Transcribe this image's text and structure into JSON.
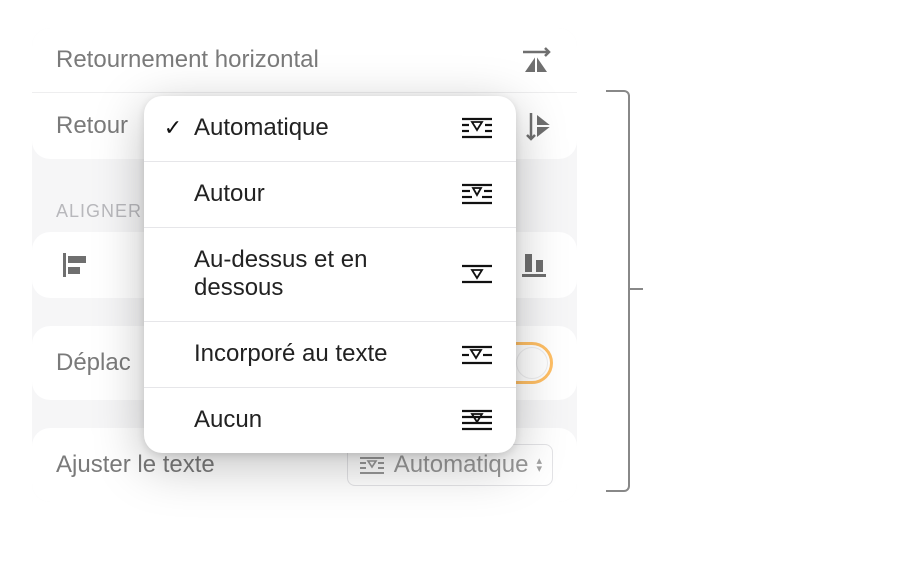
{
  "rows": {
    "flip_horizontal": "Retournement horizontal",
    "flip_vertical_prefix": "Retour"
  },
  "sections": {
    "align_header": "Aligner"
  },
  "move": {
    "label": "Déplac"
  },
  "textfit": {
    "label": "Ajuster le texte",
    "value": "Automatique"
  },
  "menu": {
    "items": [
      {
        "label": "Automatique",
        "selected": true
      },
      {
        "label": "Autour",
        "selected": false
      },
      {
        "label": "Au-dessus et en dessous",
        "selected": false
      },
      {
        "label": "Incorporé au texte",
        "selected": false
      },
      {
        "label": "Aucun",
        "selected": false
      }
    ]
  }
}
